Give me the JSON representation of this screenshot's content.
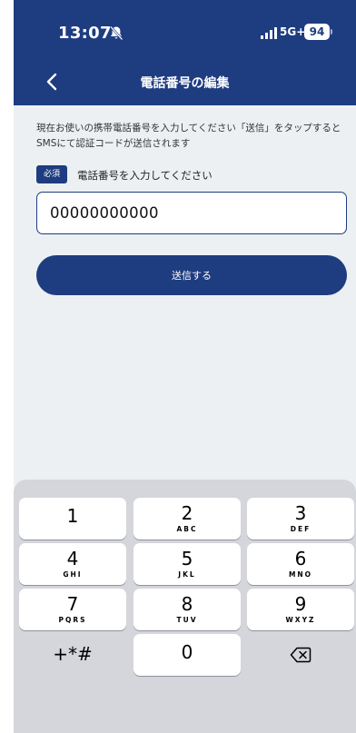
{
  "status_bar": {
    "time": "13:07",
    "network": "5G+",
    "battery": "94",
    "icons": [
      "bell-slash-icon",
      "signal-icon"
    ]
  },
  "nav": {
    "title": "電話番号の編集",
    "back_icon": "chevron-left-icon"
  },
  "form": {
    "instruction": "現在お使いの携帯電話番号を入力してください「送信」をタップするとSMSにて認証コードが送信されます",
    "required_badge": "必須",
    "field_label": "電話番号を入力してください",
    "phone_value": "00000000000",
    "submit_label": "送信する"
  },
  "keypad": {
    "keys": [
      {
        "digit": "1",
        "letters": ""
      },
      {
        "digit": "2",
        "letters": "ABC"
      },
      {
        "digit": "3",
        "letters": "DEF"
      },
      {
        "digit": "4",
        "letters": "GHI"
      },
      {
        "digit": "5",
        "letters": "JKL"
      },
      {
        "digit": "6",
        "letters": "MNO"
      },
      {
        "digit": "7",
        "letters": "PQRS"
      },
      {
        "digit": "8",
        "letters": "TUV"
      },
      {
        "digit": "9",
        "letters": "WXYZ"
      }
    ],
    "symbols": "+*#",
    "zero": "0",
    "delete_icon": "backspace-icon"
  },
  "colors": {
    "primary": "#1e3c80",
    "background": "#edf0f3",
    "keyboard": "#d4d6db"
  }
}
